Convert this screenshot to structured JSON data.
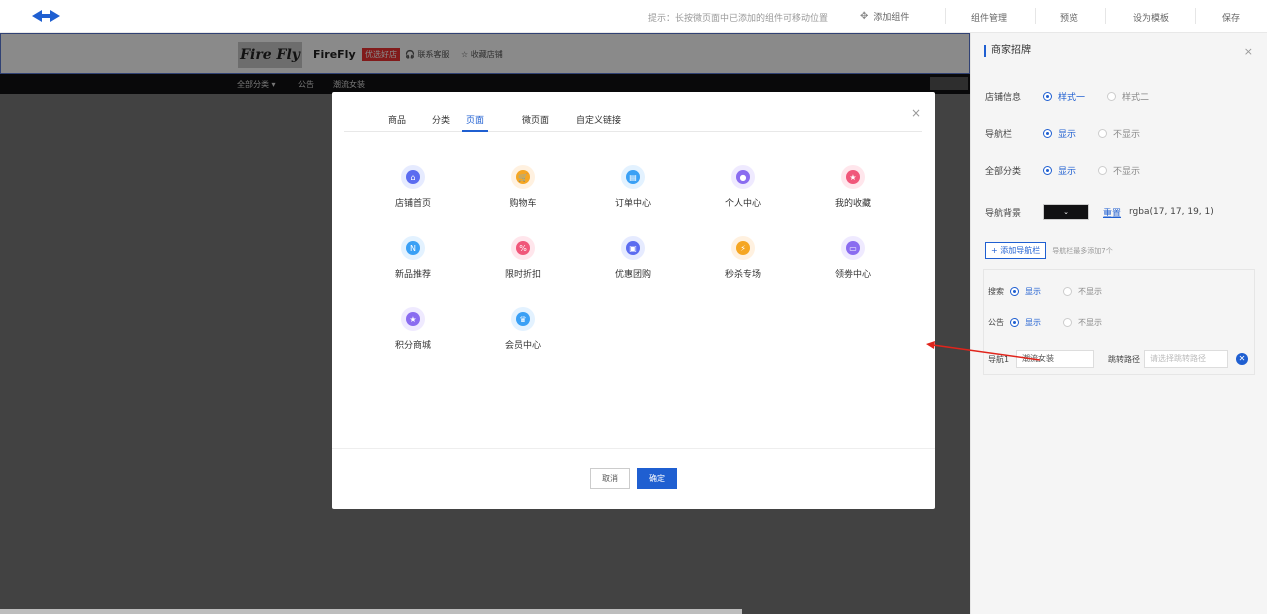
{
  "topbar": {
    "hint": "提示：长按微页面中已添加的组件可移动位置",
    "add_component": "添加组件",
    "tabs": [
      "组件管理",
      "预览",
      "设为模板",
      "保存"
    ]
  },
  "store": {
    "brand": "Fire Fly",
    "name": "FireFly",
    "badge": "优选好店",
    "contact": "联系客服",
    "favorite": "收藏店铺",
    "nav": [
      "全部分类 ▾",
      "公告",
      "潮流女装"
    ]
  },
  "modal": {
    "tabs": [
      "商品",
      "分类",
      "页面",
      "微页面",
      "自定义链接"
    ],
    "active_tab": "页面",
    "items": [
      {
        "label": "店铺首页",
        "icon": "home-icon",
        "color": "#5b6cf0",
        "bg": "#e6ebff",
        "glyph": "⌂"
      },
      {
        "label": "购物车",
        "icon": "cart-icon",
        "color": "#f5a623",
        "bg": "#fff1e0",
        "glyph": "🛒"
      },
      {
        "label": "订单中心",
        "icon": "order-icon",
        "color": "#3aa0f5",
        "bg": "#e3f2ff",
        "glyph": "▤"
      },
      {
        "label": "个人中心",
        "icon": "user-icon",
        "color": "#8a6cf0",
        "bg": "#efeaff",
        "glyph": "●"
      },
      {
        "label": "我的收藏",
        "icon": "star-icon",
        "color": "#f0577a",
        "bg": "#ffe6ec",
        "glyph": "★"
      },
      {
        "label": "新品推荐",
        "icon": "new-icon",
        "color": "#3aa0f5",
        "bg": "#e3f2ff",
        "glyph": "N"
      },
      {
        "label": "限时折扣",
        "icon": "discount-icon",
        "color": "#f0577a",
        "bg": "#ffe6ec",
        "glyph": "%"
      },
      {
        "label": "优惠团购",
        "icon": "group-buy-icon",
        "color": "#5b6cf0",
        "bg": "#e6ebff",
        "glyph": "▣"
      },
      {
        "label": "秒杀专场",
        "icon": "flash-sale-icon",
        "color": "#f5a623",
        "bg": "#fff1e0",
        "glyph": "⚡"
      },
      {
        "label": "领劵中心",
        "icon": "coupon-icon",
        "color": "#8a6cf0",
        "bg": "#efeaff",
        "glyph": "▭"
      },
      {
        "label": "积分商城",
        "icon": "points-icon",
        "color": "#8a6cf0",
        "bg": "#efeaff",
        "glyph": "★"
      },
      {
        "label": "会员中心",
        "icon": "vip-icon",
        "color": "#3aa0f5",
        "bg": "#e3f2ff",
        "glyph": "♛"
      }
    ],
    "cancel": "取消",
    "ok": "确定"
  },
  "panel": {
    "title": "商家招牌",
    "rows": [
      {
        "label": "店铺信息",
        "options": [
          "样式一",
          "样式二"
        ],
        "selected": 0
      },
      {
        "label": "导航栏",
        "options": [
          "显示",
          "不显示"
        ],
        "selected": 0
      },
      {
        "label": "全部分类",
        "options": [
          "显示",
          "不显示"
        ],
        "selected": 0
      }
    ],
    "nav_bg_label": "导航背景",
    "nav_bg_reset": "重置",
    "nav_bg_value": "rgba(17, 17, 19, 1)",
    "add_nav": "+ 添加导航栏",
    "add_nav_tip": "导航栏最多添加7个",
    "search_label": "搜索",
    "notice_label": "公告",
    "show": "显示",
    "hide": "不显示",
    "nav1_label": "导航1",
    "nav1_value": "潮流女装",
    "jump_label": "跳转路径",
    "jump_placeholder": "请选择跳转路径"
  }
}
